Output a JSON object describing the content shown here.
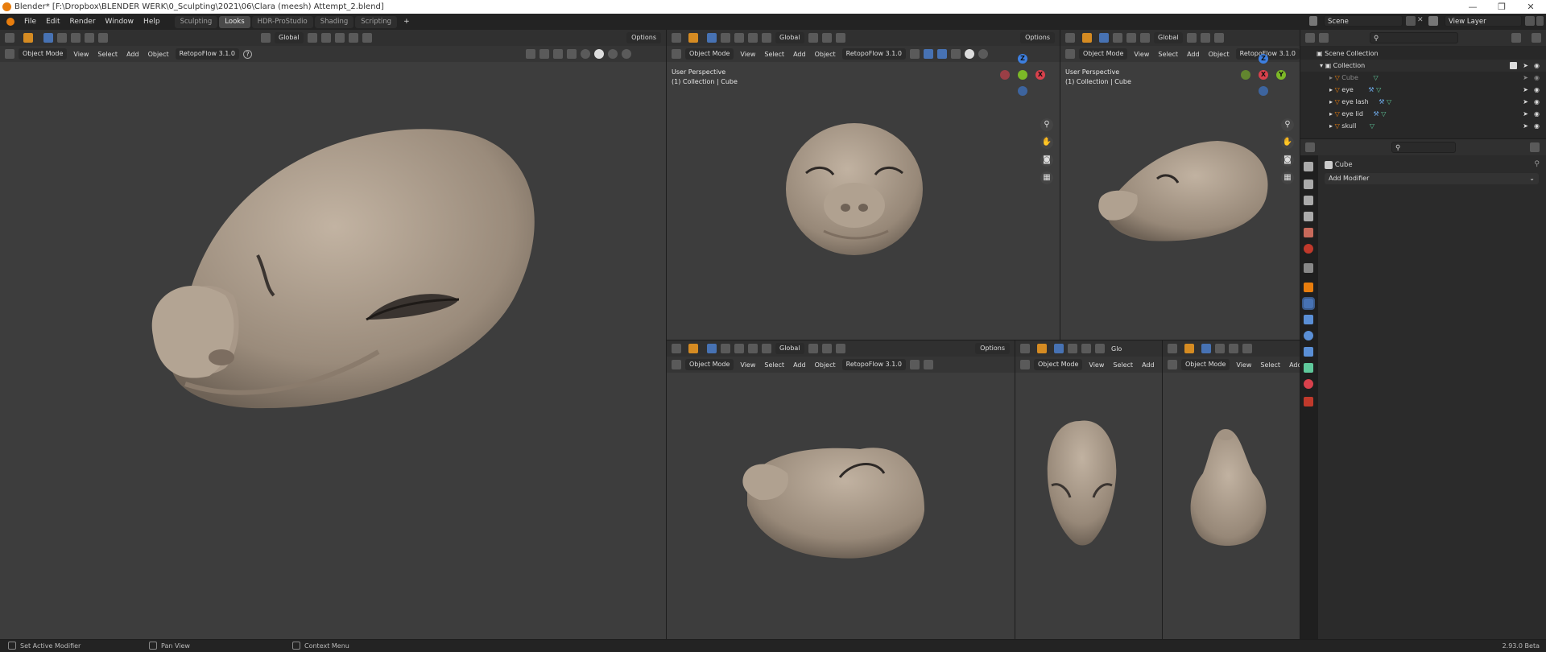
{
  "window": {
    "title": "Blender* [F:\\Dropbox\\BLENDER WERK\\0_Sculpting\\2021\\06\\Clara (meesh) Attempt_2.blend]",
    "controls": [
      "—",
      "❐",
      "✕"
    ]
  },
  "menubar": {
    "items": [
      "File",
      "Edit",
      "Render",
      "Window",
      "Help"
    ],
    "workspaces": [
      {
        "label": "Sculpting",
        "active": false
      },
      {
        "label": "Looks",
        "active": true
      },
      {
        "label": "HDR-ProStudio",
        "active": false
      },
      {
        "label": "Shading",
        "active": false
      },
      {
        "label": "Scripting",
        "active": false
      }
    ],
    "add_tab": "+",
    "scene": "Scene",
    "view_layer": "View Layer"
  },
  "viewport_common": {
    "transform_orientation": "Global",
    "mode": "Object Mode",
    "menu": [
      "View",
      "Select",
      "Add",
      "Object"
    ],
    "addon": "RetopoFlow 3.1.0",
    "options": "Options",
    "help": "?"
  },
  "viewports": {
    "main": {
      "perspective": "",
      "collection": ""
    },
    "top_middle": {
      "perspective": "User Perspective",
      "collection": "(1) Collection | Cube"
    },
    "top_right": {
      "perspective": "User Perspective",
      "collection": "(1) Collection | Cube"
    },
    "bottom_right_cut": "Glo"
  },
  "gizmo": {
    "z": "Z",
    "x": "X",
    "y": "Y"
  },
  "colors": {
    "x_axis": "#d8414c",
    "y_axis": "#7cb827",
    "z_axis": "#3d7fe0",
    "accent": "#e87d0d",
    "header": "#303030",
    "viewport": "#3d3d3d"
  },
  "outliner": {
    "search_placeholder": "",
    "root": "Scene Collection",
    "collection": "Collection",
    "items": [
      {
        "label": "Cube",
        "dimmed": true
      },
      {
        "label": "eye",
        "dimmed": false
      },
      {
        "label": "eye lash",
        "dimmed": false
      },
      {
        "label": "eye lid",
        "dimmed": false
      },
      {
        "label": "skull",
        "dimmed": false
      }
    ]
  },
  "properties": {
    "object_name": "Cube",
    "add_modifier": "Add Modifier"
  },
  "statusbar": {
    "left": "Set Active Modifier",
    "middle": "Pan View",
    "right_hint": "Context Menu",
    "version": "2.93.0 Beta"
  }
}
